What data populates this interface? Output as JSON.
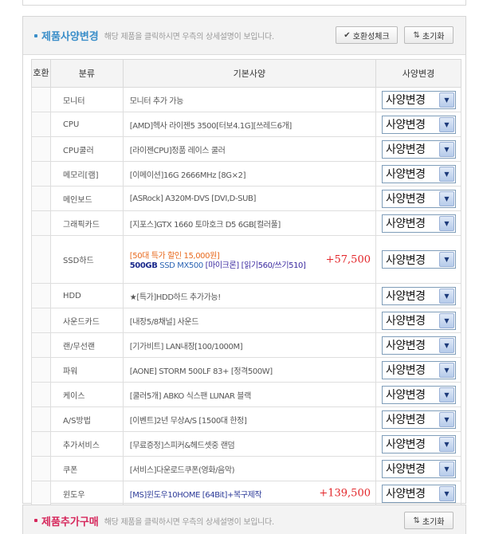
{
  "spec_section": {
    "title": "제품사양변경",
    "description": "해당 제품을 클릭하시면 우측의 상세설명이 보입니다.",
    "compat_button": "호환성체크",
    "reset_button": "초기화"
  },
  "table": {
    "headers": [
      "호환",
      "분류",
      "기본사양",
      "사양변경"
    ],
    "select_label": "사양변경",
    "rows": [
      {
        "category": "모니터",
        "spec": "모니터 추가 가능"
      },
      {
        "category": "CPU",
        "spec": "[AMD]헥사 라이젠5 3500[터보4.1G][쓰레드6개]"
      },
      {
        "category": "CPU쿨러",
        "spec": "[라이젠CPU]정품 레이스 쿨러"
      },
      {
        "category": "메모리[램]",
        "spec": "[이메이션]16G 2666MHz [8G×2]"
      },
      {
        "category": "메인보드",
        "spec": "[ASRock] A320M-DVS [DVI,D-SUB]"
      },
      {
        "category": "그래픽카드",
        "spec": "[지포스]GTX 1660 토마호크 D5 6GB[컬러풀]"
      },
      {
        "category": "SSD하드",
        "promo": "[50대 특가 할인 15,000원]",
        "capacity": "500GB",
        "model": "SSD MX500",
        "maker": "[마이크론]",
        "rest": "[읽기560/쓰기510]",
        "price": "+57,500"
      },
      {
        "category": "HDD",
        "spec": "★[특가]HDD하드 추가가능!"
      },
      {
        "category": "사운드카드",
        "spec": "[내장5/8채널] 사운드"
      },
      {
        "category": "랜/무선랜",
        "spec": "[기가비트] LAN내장[100/1000M]"
      },
      {
        "category": "파워",
        "spec": "[AONE] STORM 500LF 83+ [정격500W]"
      },
      {
        "category": "케이스",
        "spec": "[쿨러5개] ABKO 식스팬 LUNAR 블랙"
      },
      {
        "category": "A/S방법",
        "spec": "[이벤트]2년 무상A/S [1500대 한정]"
      },
      {
        "category": "추가서비스",
        "spec": "[무료증정]스피커&헤드셋중 랜덤"
      },
      {
        "category": "쿠폰",
        "spec": "[서비스]다운로드쿠폰(영화/음악)"
      },
      {
        "category": "윈도우",
        "spec": "[MS]윈도우10HOME [64Bit]+복구제작",
        "price": "+139,500"
      }
    ]
  },
  "extra_section": {
    "title": "제품추가구매",
    "description": "해당 제품을 클릭하시면 우측의 상세설명이 보입니다.",
    "reset_button": "초기화"
  },
  "colors": {
    "accent_blue": "#3a8ec9",
    "accent_pink": "#d6285c",
    "price_red": "#e3262a",
    "promo_orange": "#e86a1e"
  },
  "icons": {
    "compat": "check-icon",
    "reset": "sort-arrows-icon",
    "select": "chevron-down-icon"
  }
}
